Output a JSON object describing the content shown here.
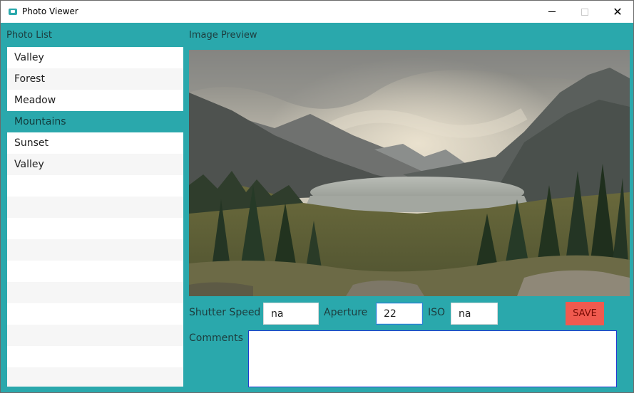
{
  "window": {
    "title": "Photo Viewer",
    "controls": {
      "minimize": "minimize",
      "maximize": "maximize",
      "close": "close"
    }
  },
  "photo_list": {
    "label": "Photo List",
    "items": [
      "Valley",
      "Forest",
      "Meadow",
      "Mountains",
      "Sunset",
      "Valley"
    ],
    "selected_index": 3
  },
  "preview": {
    "label": "Image Preview",
    "subject": "mountain lake landscape"
  },
  "fields": {
    "shutter_label": "Shutter Speed",
    "shutter_value": "na",
    "aperture_label": "Aperture",
    "aperture_value": "22",
    "iso_label": "ISO",
    "iso_value": "na",
    "comments_label": "Comments",
    "comments_value": ""
  },
  "save_button": "SAVE",
  "colors": {
    "background": "#2aa8ac",
    "selected_row": "#2aa8ac",
    "save_button": "#f05a4f",
    "focus_border": "#2b7fd6"
  }
}
